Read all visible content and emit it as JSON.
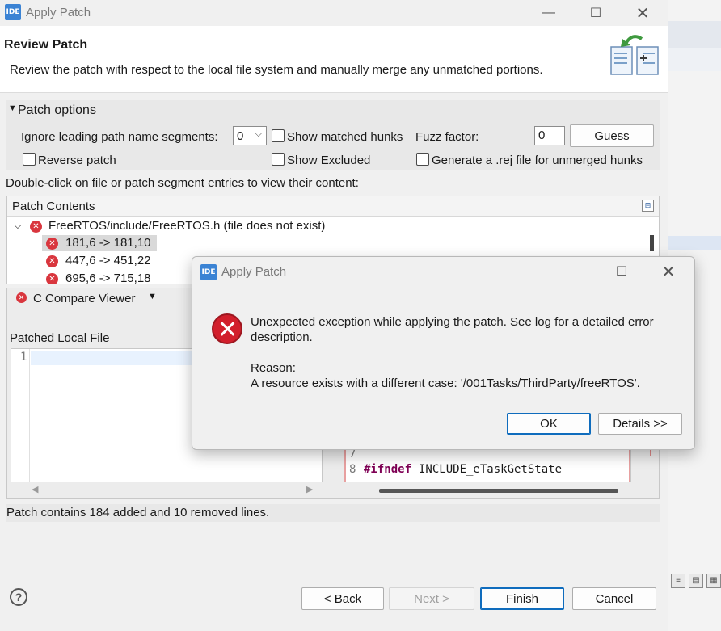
{
  "main_window": {
    "logo": "IDE",
    "title": "Apply Patch",
    "header": {
      "title": "Review Patch",
      "description": "Review the patch with respect to the local file system and manually merge any unmatched portions."
    },
    "patch_options": {
      "section_label": "Patch options",
      "ignore_segments_label": "Ignore leading path name segments:",
      "ignore_segments_value": "0",
      "show_matched_hunks_label": "Show matched hunks",
      "fuzz_factor_label": "Fuzz factor:",
      "fuzz_factor_value": "0",
      "guess_label": "Guess",
      "reverse_patch_label": "Reverse patch",
      "show_excluded_label": "Show Excluded",
      "generate_rej_label": "Generate a .rej file for unmerged hunks"
    },
    "hint": "Double-click on file or patch segment entries to view their content:",
    "patch_contents": {
      "header": "Patch Contents",
      "file": "FreeRTOS/include/FreeRTOS.h (file does not exist)",
      "hunks": [
        "181,6 -> 181,10",
        "447,6 -> 451,22",
        "695,6 -> 715,18"
      ]
    },
    "compare": {
      "viewer_label": "C Compare Viewer",
      "left_title": "Patched Local File",
      "left_lines": [
        "1"
      ],
      "right_lines": [
        {
          "num": "7",
          "keyword": "",
          "text": ""
        },
        {
          "num": "8",
          "keyword": "#ifndef",
          "text": " INCLUDE_eTaskGetState"
        }
      ]
    },
    "status": "Patch contains 184 added and 10 removed lines.",
    "buttons": {
      "back": "< Back",
      "next": "Next >",
      "finish": "Finish",
      "cancel": "Cancel"
    }
  },
  "error_dialog": {
    "logo": "IDE",
    "title": "Apply Patch",
    "message_line1": "Unexpected exception while applying the patch. See log for a detailed error",
    "message_line2": "description.",
    "reason_label": "Reason:",
    "reason_text": "A resource exists with a different case: '/001Tasks/ThirdParty/freeRTOS'.",
    "ok": "OK",
    "details": "Details >>"
  },
  "icons": [
    "ide-logo",
    "minimize-icon",
    "maximize-icon",
    "close-icon",
    "patch-wizard-icon",
    "collapse-arrow-icon",
    "chevron-down-icon",
    "error-file-icon",
    "error-hunk-icon",
    "collapse-all-icon",
    "help-icon",
    "error-icon"
  ]
}
